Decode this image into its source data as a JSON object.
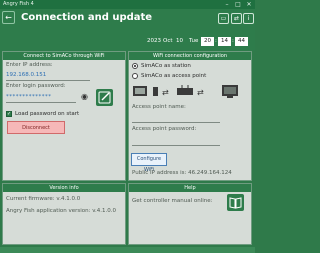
{
  "app": {
    "title": "Angry Fish 4"
  },
  "window": {
    "minimize": "–",
    "maximize": "□",
    "close": "✕"
  },
  "header": {
    "title": "Connection and update",
    "back_icon": "back-arrow-icon",
    "datetime": {
      "year": "2023",
      "month": "Oct",
      "day": "10",
      "weekday": "Tue",
      "hour": "20",
      "minute": "14",
      "second": "44"
    }
  },
  "connect_panel": {
    "title": "Connect to SimACo through WiFi",
    "ip_label": "Enter IP address:",
    "ip_value": "192.168.0.151",
    "password_label": "Enter login password:",
    "password_value": "**************",
    "load_password_label": "Load password on start",
    "disconnect_label": "Disconnect"
  },
  "wifi_panel": {
    "title": "WiFi connection configuration",
    "option_station": "SimACo as station",
    "option_ap": "SimACo as access point",
    "ap_name_label": "Access point name:",
    "ap_password_label": "Access point password:",
    "configure_label": "Configure WiFi",
    "public_ip_text": "Public IP address is: 46.249.164.124"
  },
  "version_panel": {
    "title": "Version info",
    "firmware": "Current firmware: v.4.1.0.0",
    "app_version": "Angry Fish application version: v.4.1.0.0"
  },
  "help_panel": {
    "title": "Help",
    "manual_text": "Get controller manual online:"
  },
  "colors": {
    "brand_green": "#2e7c4b",
    "panel_bg": "#d6dcd7",
    "link_blue": "#2d6fb3",
    "disconnect_bg": "#f6b8b8"
  }
}
